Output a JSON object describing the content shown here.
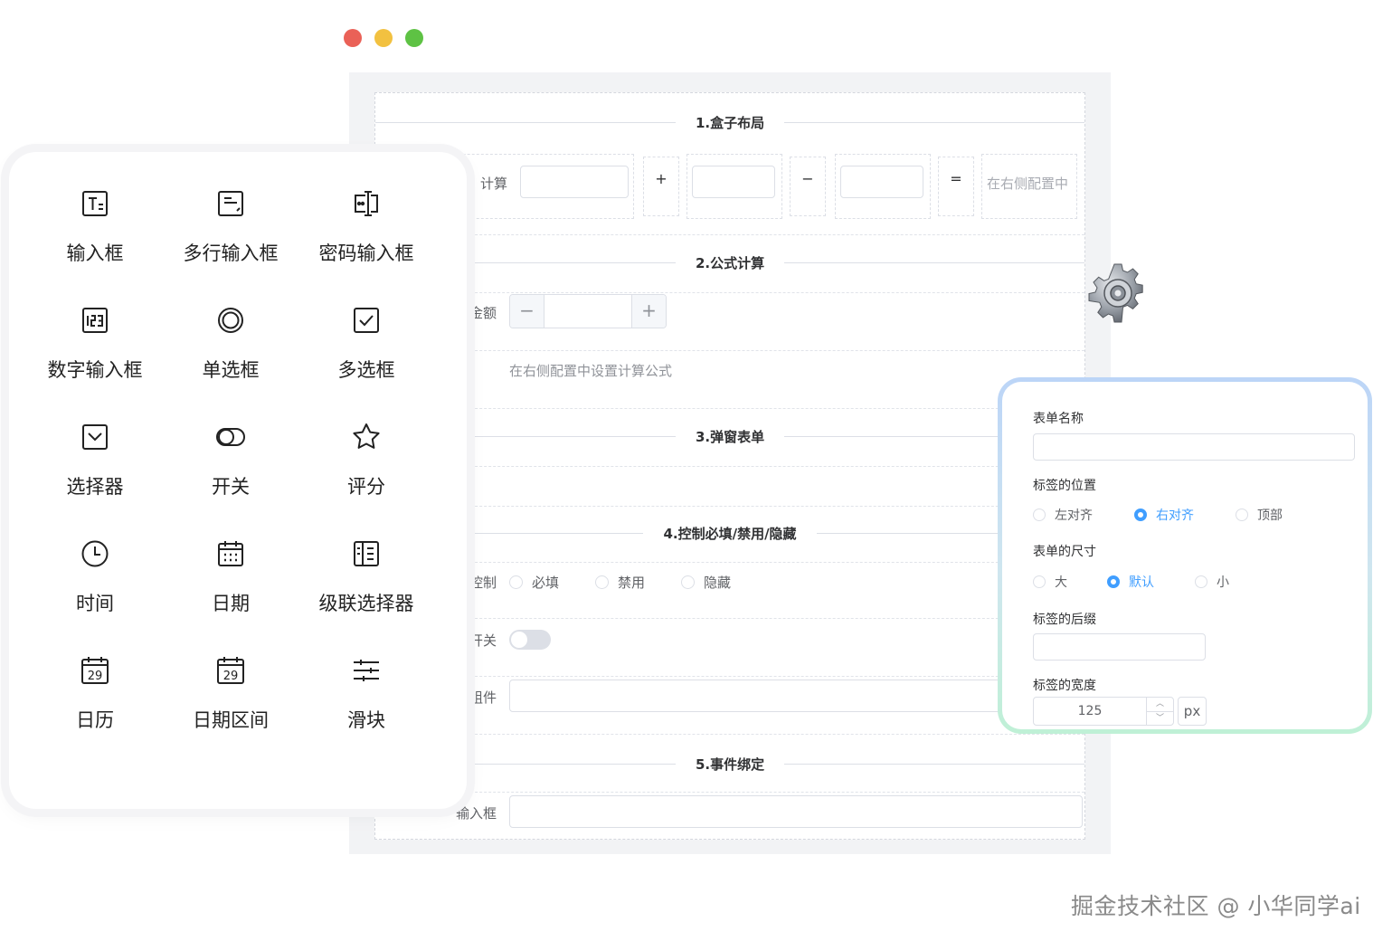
{
  "window": {
    "controls": [
      "close",
      "minimize",
      "maximize"
    ]
  },
  "form": {
    "sections": [
      {
        "title": "1.盒子布局"
      },
      {
        "title": "2.公式计算"
      },
      {
        "title": "3.弹窗表单"
      },
      {
        "title": "4.控制必填/禁用/隐藏"
      },
      {
        "title": "5.事件绑定"
      }
    ],
    "calc_row": {
      "label": "计算",
      "plus": "+",
      "minus": "−",
      "equals": "=",
      "result_placeholder": "在右侧配置中"
    },
    "amount": {
      "label": "金额",
      "minus": "−",
      "plus": "+"
    },
    "formula_hint": "在右侧配置中设置计算公式",
    "control": {
      "label": "控制",
      "options": [
        "必填",
        "禁用",
        "隐藏"
      ]
    },
    "switch_row": {
      "label": "开关"
    },
    "component_row": {
      "label": "组件"
    },
    "event_input": {
      "label": "输入框"
    }
  },
  "palette": {
    "items": [
      {
        "label": "输入框",
        "icon": "text-input-icon"
      },
      {
        "label": "多行输入框",
        "icon": "textarea-icon"
      },
      {
        "label": "密码输入框",
        "icon": "password-input-icon"
      },
      {
        "label": "数字输入框",
        "icon": "number-input-icon"
      },
      {
        "label": "单选框",
        "icon": "radio-icon"
      },
      {
        "label": "多选框",
        "icon": "checkbox-icon"
      },
      {
        "label": "选择器",
        "icon": "select-icon"
      },
      {
        "label": "开关",
        "icon": "switch-icon"
      },
      {
        "label": "评分",
        "icon": "star-icon"
      },
      {
        "label": "时间",
        "icon": "clock-icon"
      },
      {
        "label": "日期",
        "icon": "date-icon"
      },
      {
        "label": "级联选择器",
        "icon": "cascader-icon"
      },
      {
        "label": "日历",
        "icon": "calendar-icon"
      },
      {
        "label": "日期区间",
        "icon": "date-range-icon"
      },
      {
        "label": "滑块",
        "icon": "slider-icon"
      }
    ],
    "calendar_day": "29"
  },
  "config": {
    "form_name": {
      "label": "表单名称",
      "value": ""
    },
    "label_position": {
      "label": "标签的位置",
      "options": [
        "左对齐",
        "右对齐",
        "顶部"
      ],
      "selected": "右对齐"
    },
    "form_size": {
      "label": "表单的尺寸",
      "options": [
        "大",
        "默认",
        "小"
      ],
      "selected": "默认"
    },
    "label_suffix": {
      "label": "标签的后缀",
      "value": ""
    },
    "label_width": {
      "label": "标签的宽度",
      "value": "125",
      "unit": "px",
      "up": "︿",
      "down": "﹀"
    }
  },
  "watermark": "掘金技术社区 @ 小华同学ai",
  "colors": {
    "primary": "#409eff",
    "close": "#ea6157",
    "minimize": "#f2c140",
    "maximize": "#5ec244"
  }
}
